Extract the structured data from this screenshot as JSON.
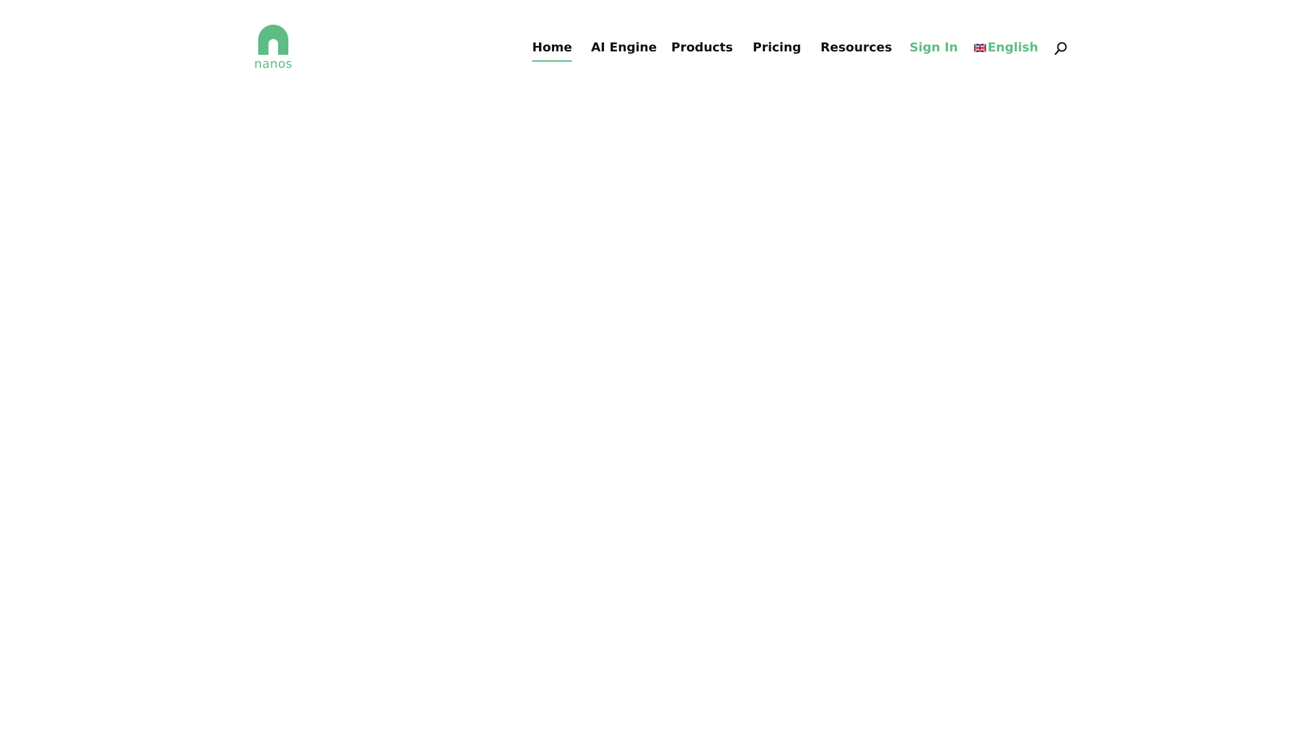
{
  "brand": {
    "name": "nanos",
    "color": "#5ebc85",
    "logo_icon": "nanos-logo-icon"
  },
  "nav": {
    "items": [
      {
        "label": "Home",
        "active": true
      },
      {
        "label": "AI Engine"
      },
      {
        "label": "Products"
      },
      {
        "label": "Pricing"
      },
      {
        "label": "Resources"
      },
      {
        "label": "Sign In"
      }
    ],
    "language": {
      "label": "English",
      "icon": "uk-flag-icon"
    },
    "search_icon": "search-icon"
  }
}
